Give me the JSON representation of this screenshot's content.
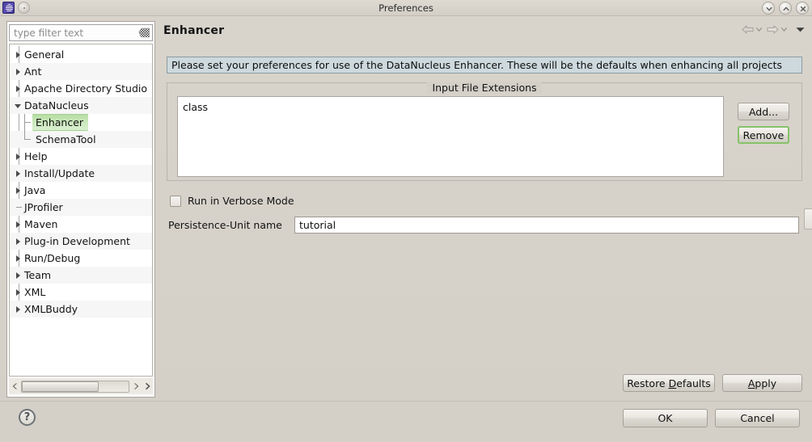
{
  "window": {
    "title": "Preferences",
    "app_icon": "eclipse-icon",
    "menu_icon": "window-menu-icon",
    "controls": [
      {
        "name": "minimize-button",
        "icon": "chevron-down-icon"
      },
      {
        "name": "maximize-button",
        "icon": "chevron-up-icon"
      },
      {
        "name": "close-button",
        "icon": "close-icon"
      }
    ]
  },
  "sidebar": {
    "filter": {
      "placeholder": "type filter text",
      "value": "",
      "clear_icon": "eraser-icon"
    },
    "items": [
      {
        "label": "General",
        "state": "collapsed",
        "depth": 0,
        "selected": false
      },
      {
        "label": "Ant",
        "state": "collapsed",
        "depth": 0,
        "selected": false
      },
      {
        "label": "Apache Directory Studio",
        "state": "collapsed",
        "depth": 0,
        "selected": false
      },
      {
        "label": "DataNucleus",
        "state": "expanded",
        "depth": 0,
        "selected": false
      },
      {
        "label": "Enhancer",
        "state": "child",
        "depth": 1,
        "selected": true
      },
      {
        "label": "SchemaTool",
        "state": "child-last",
        "depth": 1,
        "selected": false
      },
      {
        "label": "Help",
        "state": "collapsed",
        "depth": 0,
        "selected": false
      },
      {
        "label": "Install/Update",
        "state": "collapsed",
        "depth": 0,
        "selected": false
      },
      {
        "label": "Java",
        "state": "collapsed",
        "depth": 0,
        "selected": false
      },
      {
        "label": "JProfiler",
        "state": "leaf",
        "depth": 0,
        "selected": false
      },
      {
        "label": "Maven",
        "state": "collapsed",
        "depth": 0,
        "selected": false
      },
      {
        "label": "Plug-in Development",
        "state": "collapsed",
        "depth": 0,
        "selected": false
      },
      {
        "label": "Run/Debug",
        "state": "collapsed",
        "depth": 0,
        "selected": false
      },
      {
        "label": "Team",
        "state": "collapsed",
        "depth": 0,
        "selected": false
      },
      {
        "label": "XML",
        "state": "collapsed",
        "depth": 0,
        "selected": false
      },
      {
        "label": "XMLBuddy",
        "state": "collapsed",
        "depth": 0,
        "selected": false
      }
    ],
    "scrollbar": {
      "left_arrow_icon": "chevron-left-icon",
      "right_arrow_icon": "chevron-right-icon",
      "extra_right_arrow_icon": "chevron-right-icon",
      "thumb_position_percent": 0,
      "thumb_width_percent": 72
    }
  },
  "content": {
    "title": "Enhancer",
    "nav": {
      "back_icon": "arrow-left-icon",
      "back_dropdown_icon": "chevron-down-icon",
      "forward_icon": "arrow-right-icon",
      "forward_dropdown_icon": "chevron-down-icon",
      "view_menu_icon": "triangle-down-icon"
    },
    "banner": {
      "text": "Please set your preferences for use of the DataNucleus Enhancer. These will be the defaults when enhancing all projects",
      "background": "#cdd9dd",
      "border": "#8d9ba0"
    },
    "group": {
      "title": "Input File Extensions",
      "list_items": [
        "class"
      ],
      "add_button": "Add...",
      "remove_button": "Remove",
      "remove_focused": true
    },
    "verbose": {
      "label": "Run in Verbose Mode",
      "checked": false
    },
    "persistence_unit": {
      "label": "Persistence-Unit name",
      "value": "tutorial"
    },
    "restore_defaults": {
      "pre": "Restore ",
      "mnemonic": "D",
      "post": "efaults"
    },
    "apply": {
      "pre": "",
      "mnemonic": "A",
      "post": "pply"
    }
  },
  "footer": {
    "help_icon": "question-mark-icon",
    "help_glyph": "?",
    "ok_label": "OK",
    "cancel_label": "Cancel"
  },
  "colors": {
    "window_bg": "#d4d0c8",
    "selection_green": "#b6dea3",
    "focus_green": "#86c26a",
    "banner_blue": "#cdd9dd"
  }
}
